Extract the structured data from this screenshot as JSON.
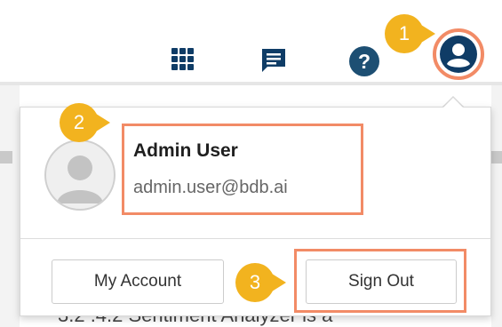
{
  "header": {
    "icons": [
      {
        "name": "apps-grid-icon"
      },
      {
        "name": "chat-icon"
      },
      {
        "name": "help-icon"
      },
      {
        "name": "user-profile-icon"
      }
    ],
    "help_glyph": "?"
  },
  "profile_menu": {
    "user_name": "Admin User",
    "user_email": "admin.user@bdb.ai",
    "my_account_label": "My Account",
    "sign_out_label": "Sign Out"
  },
  "markers": {
    "step1": "1",
    "step2": "2",
    "step3": "3"
  },
  "background": {
    "partial_text": "3.2 .4.2 Sentiment Analyzer is a"
  },
  "colors": {
    "brand_navy": "#0f3c66",
    "help_teal": "#1d4f73",
    "highlight_orange": "#f28b66",
    "marker_yellow": "#f2b31f"
  }
}
